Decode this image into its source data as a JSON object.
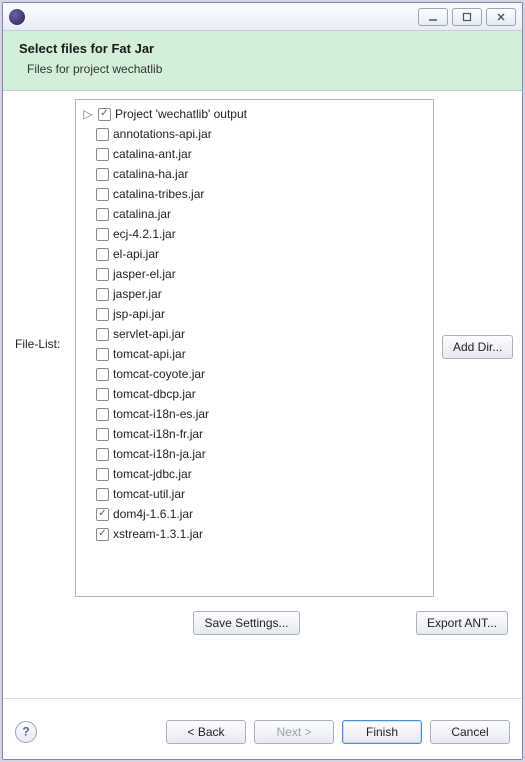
{
  "window": {
    "title": ""
  },
  "header": {
    "title": "Select files for Fat Jar",
    "subtitle": "Files for project wechatlib"
  },
  "labels": {
    "file_list": "File-List:",
    "add_dir": "Add Dir...",
    "save_settings": "Save Settings...",
    "export_ant": "Export ANT..."
  },
  "tree": {
    "items": [
      {
        "label": "Project 'wechatlib' output",
        "checked": true,
        "expandable": true
      },
      {
        "label": "annotations-api.jar",
        "checked": false,
        "expandable": false
      },
      {
        "label": "catalina-ant.jar",
        "checked": false,
        "expandable": false
      },
      {
        "label": "catalina-ha.jar",
        "checked": false,
        "expandable": false
      },
      {
        "label": "catalina-tribes.jar",
        "checked": false,
        "expandable": false
      },
      {
        "label": "catalina.jar",
        "checked": false,
        "expandable": false
      },
      {
        "label": "ecj-4.2.1.jar",
        "checked": false,
        "expandable": false
      },
      {
        "label": "el-api.jar",
        "checked": false,
        "expandable": false
      },
      {
        "label": "jasper-el.jar",
        "checked": false,
        "expandable": false
      },
      {
        "label": "jasper.jar",
        "checked": false,
        "expandable": false
      },
      {
        "label": "jsp-api.jar",
        "checked": false,
        "expandable": false
      },
      {
        "label": "servlet-api.jar",
        "checked": false,
        "expandable": false
      },
      {
        "label": "tomcat-api.jar",
        "checked": false,
        "expandable": false
      },
      {
        "label": "tomcat-coyote.jar",
        "checked": false,
        "expandable": false
      },
      {
        "label": "tomcat-dbcp.jar",
        "checked": false,
        "expandable": false
      },
      {
        "label": "tomcat-i18n-es.jar",
        "checked": false,
        "expandable": false
      },
      {
        "label": "tomcat-i18n-fr.jar",
        "checked": false,
        "expandable": false
      },
      {
        "label": "tomcat-i18n-ja.jar",
        "checked": false,
        "expandable": false
      },
      {
        "label": "tomcat-jdbc.jar",
        "checked": false,
        "expandable": false
      },
      {
        "label": "tomcat-util.jar",
        "checked": false,
        "expandable": false
      },
      {
        "label": "dom4j-1.6.1.jar",
        "checked": true,
        "expandable": false
      },
      {
        "label": "xstream-1.3.1.jar",
        "checked": true,
        "expandable": false
      }
    ]
  },
  "footer": {
    "back": "< Back",
    "next": "Next >",
    "finish": "Finish",
    "cancel": "Cancel"
  }
}
